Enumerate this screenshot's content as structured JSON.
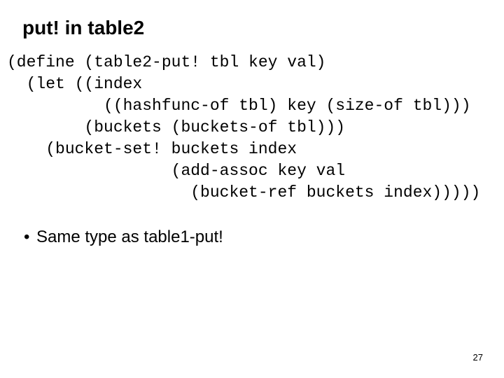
{
  "title": "put! in table2",
  "code": {
    "l1": "(define (table2-put! tbl key val)",
    "l2": "  (let ((index",
    "l3": "          ((hashfunc-of tbl) key (size-of tbl)))",
    "l4": "        (buckets (buckets-of tbl)))",
    "l5": "    (bucket-set! buckets index",
    "l6": "                 (add-assoc key val",
    "l7": "                   (bucket-ref buckets index)))))"
  },
  "bullet1": "Same type as table1-put!",
  "page_number": "27"
}
